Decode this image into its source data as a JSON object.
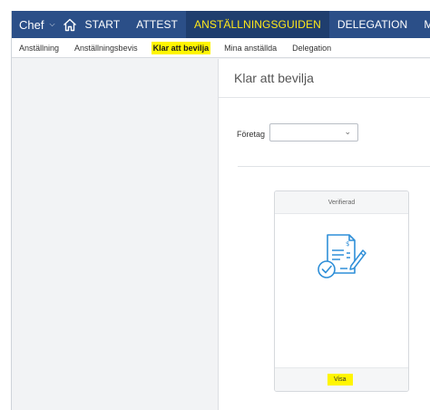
{
  "topnav": {
    "user_menu": "Chef",
    "items": [
      {
        "label": "START",
        "active": false
      },
      {
        "label": "ATTEST",
        "active": false
      },
      {
        "label": "ANSTÄLLNINGSGUIDEN",
        "active": true
      },
      {
        "label": "DELEGATION",
        "active": false
      },
      {
        "label": "MINA AN",
        "active": false
      }
    ],
    "colors": {
      "bar": "#2b4f88",
      "active_bg": "#1f3e6e",
      "active_text": "#ffe81a"
    }
  },
  "subnav": {
    "items": [
      {
        "label": "Anställning",
        "active": false
      },
      {
        "label": "Anställningsbevis",
        "active": false
      },
      {
        "label": "Klar att bevilja",
        "active": true
      },
      {
        "label": "Mina anställda",
        "active": false
      },
      {
        "label": "Delegation",
        "active": false
      }
    ],
    "highlight_color": "#fff500"
  },
  "main": {
    "title": "Klar att bevilja",
    "filter": {
      "label": "Företag",
      "value": ""
    },
    "card": {
      "status": "Verifierad",
      "icon": "verified-document-icon",
      "action_label": "Visa"
    }
  }
}
